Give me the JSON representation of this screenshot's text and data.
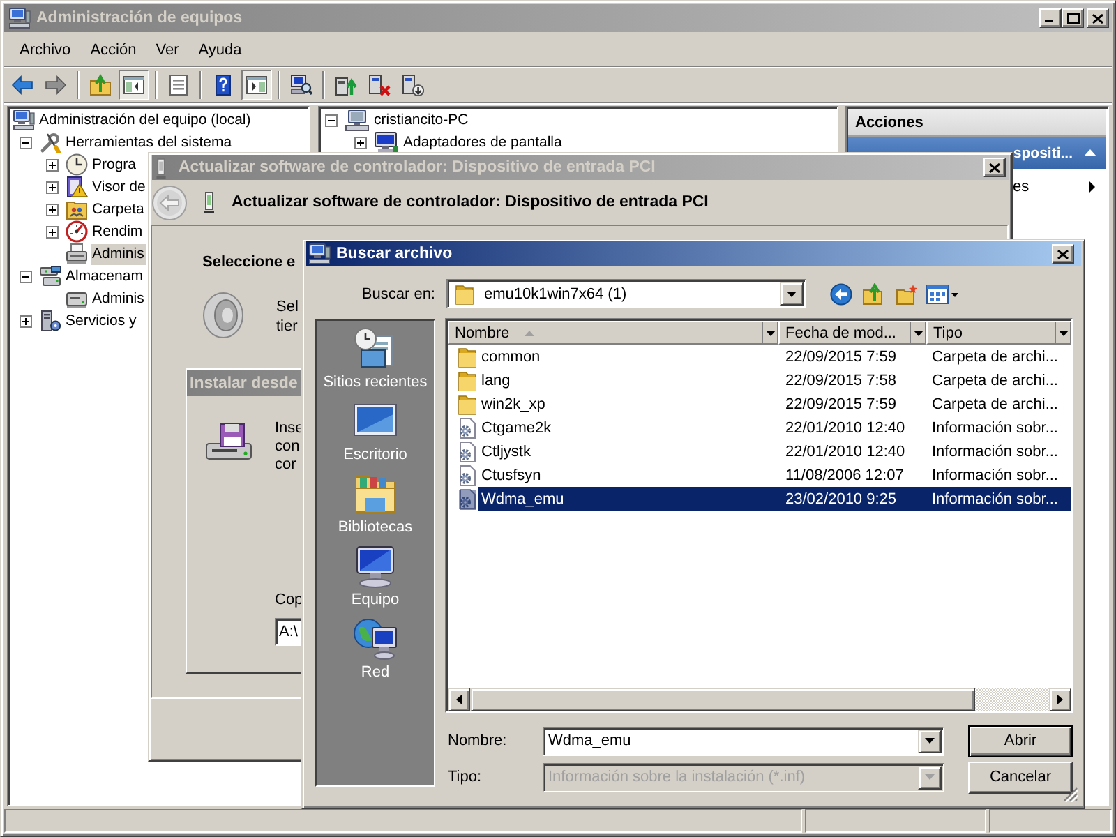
{
  "main_window": {
    "title": "Administración de equipos",
    "active": false
  },
  "menu": [
    "Archivo",
    "Acción",
    "Ver",
    "Ayuda"
  ],
  "toolbar": {
    "console_tree_pressed": true,
    "action_pane_pressed": true
  },
  "console_tree": [
    {
      "kind": "computer",
      "label": "Administración del equipo (local)",
      "selected": false,
      "children": [
        {
          "kind": "tools",
          "label": "Herramientas del sistema",
          "expanded": true,
          "selected": false,
          "children": [
            {
              "kind": "scheduler",
              "label": "Progra",
              "expanded": false,
              "selected": false
            },
            {
              "kind": "events",
              "label": "Visor de",
              "expanded": false,
              "selected": false
            },
            {
              "kind": "folders",
              "label": "Carpeta",
              "expanded": false,
              "selected": false
            },
            {
              "kind": "performance",
              "label": "Rendim",
              "expanded": false,
              "selected": false
            },
            {
              "kind": "devices",
              "label": "Adminis",
              "selected": true
            }
          ]
        },
        {
          "kind": "storage",
          "label": "Almacenam",
          "expanded": true,
          "selected": false,
          "children": [
            {
              "kind": "disk",
              "label": "Adminis",
              "selected": false
            }
          ]
        },
        {
          "kind": "services",
          "label": "Servicios y",
          "expanded": false,
          "selected": false
        }
      ]
    }
  ],
  "device_tree": [
    {
      "kind": "pc",
      "label": "cristiancito-PC",
      "expanded": true,
      "selected": false,
      "children": [
        {
          "kind": "display",
          "label": "Adaptadores de pantalla",
          "expanded": false,
          "selected": false
        }
      ]
    }
  ],
  "actions": {
    "title": "Acciones",
    "section": {
      "label": "spositi...",
      "expanded": true
    },
    "items": [
      {
        "label": "es",
        "submenu": true
      }
    ]
  },
  "driver_dialog": {
    "title": "Actualizar software de controlador: Dispositivo de entrada PCI",
    "active": false,
    "heading": "Actualizar software de controlador: Dispositivo de entrada PCI",
    "prompt": "Seleccione e",
    "lines": [
      "Sel",
      "tier"
    ],
    "install_dialog": {
      "title": "Instalar desde",
      "active": false,
      "lines": [
        "Inse",
        "con",
        "cor"
      ],
      "copy_label": "Cop",
      "copy_value": "A:\\"
    }
  },
  "file_dialog": {
    "title": "Buscar archivo",
    "active": true,
    "look_in_label": "Buscar en:",
    "look_in": "emu10k1win7x64 (1)",
    "places": [
      {
        "kind": "recent",
        "label": "Sitios recientes",
        "selected": false
      },
      {
        "kind": "desktop",
        "label": "Escritorio",
        "selected": false
      },
      {
        "kind": "libraries",
        "label": "Bibliotecas",
        "selected": false
      },
      {
        "kind": "computer",
        "label": "Equipo",
        "selected": false
      },
      {
        "kind": "network",
        "label": "Red",
        "selected": false
      }
    ],
    "columns": [
      {
        "label": "Nombre",
        "sorted": true
      },
      {
        "label": "Fecha de mod...",
        "sorted": false
      },
      {
        "label": "Tipo",
        "sorted": false
      }
    ],
    "files": [
      {
        "kind": "folder",
        "name": "common",
        "date": "22/09/2015 7:59",
        "type": "Carpeta de archi...",
        "selected": false
      },
      {
        "kind": "folder",
        "name": "lang",
        "date": "22/09/2015 7:58",
        "type": "Carpeta de archi...",
        "selected": false
      },
      {
        "kind": "folder",
        "name": "win2k_xp",
        "date": "22/09/2015 7:59",
        "type": "Carpeta de archi...",
        "selected": false
      },
      {
        "kind": "file",
        "name": "Ctgame2k",
        "date": "22/01/2010 12:40",
        "type": "Información sobr...",
        "selected": false
      },
      {
        "kind": "file",
        "name": "Ctljystk",
        "date": "22/01/2010 12:40",
        "type": "Información sobr...",
        "selected": false
      },
      {
        "kind": "file",
        "name": "Ctusfsyn",
        "date": "11/08/2006 12:07",
        "type": "Información sobr...",
        "selected": false
      },
      {
        "kind": "file",
        "name": "Wdma_emu",
        "date": "23/02/2010 9:25",
        "type": "Información sobr...",
        "selected": true
      }
    ],
    "name_label": "Nombre:",
    "name_value": "Wdma_emu",
    "type_label": "Tipo:",
    "type_value": "Información sobre la instalación (*.inf)",
    "type_disabled": true,
    "buttons": [
      {
        "label": "Abrir",
        "default": true
      },
      {
        "label": "Cancelar",
        "default": false
      }
    ]
  }
}
